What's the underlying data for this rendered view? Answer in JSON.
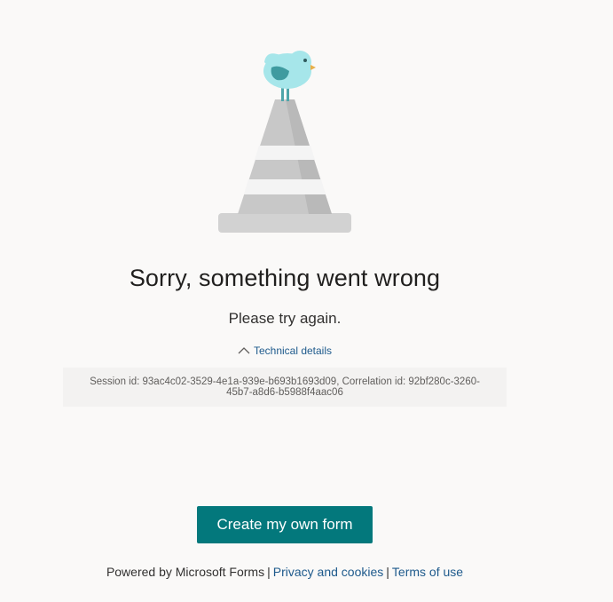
{
  "error": {
    "title": "Sorry, something went wrong",
    "subtitle": "Please try again.",
    "details_toggle_label": "Technical details",
    "details_text": "Session id: 93ac4c02-3529-4e1a-939e-b693b1693d09, Correlation id: 92bf280c-3260-45b7-a8d6-b5988f4aac06"
  },
  "cta": {
    "label": "Create my own form"
  },
  "footer": {
    "powered_by": "Powered by Microsoft Forms",
    "separator": "|",
    "privacy_link": "Privacy and cookies",
    "terms_link": "Terms of use"
  },
  "icons": {
    "illustration": "traffic-cone-with-bird",
    "toggle": "chevron-up-icon"
  },
  "colors": {
    "background": "#faf9f8",
    "primary": "#03787c",
    "link": "#1e5a8c",
    "details_bg": "#f3f2f1",
    "bird": "#a6e6ea"
  }
}
